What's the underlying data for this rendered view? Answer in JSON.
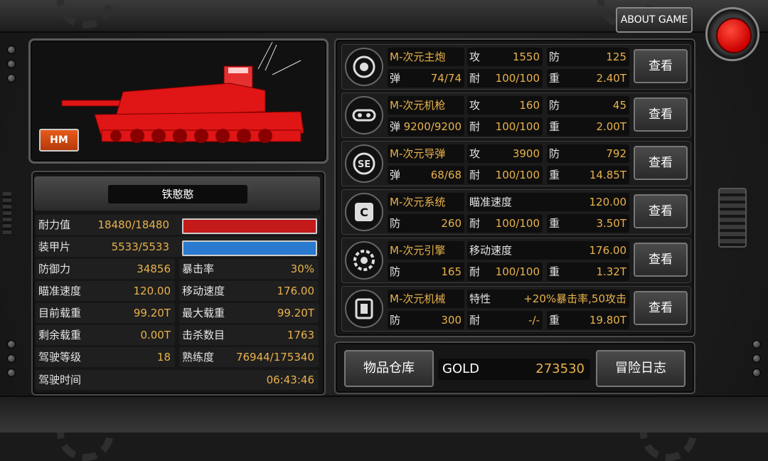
{
  "top": {
    "about_label": "ABOUT GAME"
  },
  "tank": {
    "tag": "HM",
    "name": "铁憨憨"
  },
  "stats": {
    "hp": {
      "label": "耐力值",
      "value": "18480/18480",
      "fill": 1.0
    },
    "armor": {
      "label": "装甲片",
      "value": "5533/5533",
      "fill": 1.0
    },
    "rows": [
      {
        "l1": "防御力",
        "v1": "34856",
        "l2": "暴击率",
        "v2": "30%"
      },
      {
        "l1": "瞄准速度",
        "v1": "120.00",
        "l2": "移动速度",
        "v2": "176.00"
      },
      {
        "l1": "目前载重",
        "v1": "99.20T",
        "l2": "最大载重",
        "v2": "99.20T"
      },
      {
        "l1": "剩余载重",
        "v1": "0.00T",
        "l2": "击杀数目",
        "v2": "1763"
      },
      {
        "l1": "驾驶等级",
        "v1": "18",
        "l2": "熟练度",
        "v2": "76944/175340"
      }
    ],
    "drive_time": {
      "label": "驾驶时间",
      "value": "06:43:46"
    }
  },
  "equipment": [
    {
      "name": "M-次元主炮",
      "k1": "攻",
      "v1": "1550",
      "k2": "防",
      "v2": "125",
      "k3": "弹",
      "v3": "74/74",
      "k4": "耐",
      "v4": "100/100",
      "k5": "重",
      "v5": "2.40T",
      "icon": "cannon-icon"
    },
    {
      "name": "M-次元机枪",
      "k1": "攻",
      "v1": "160",
      "k2": "防",
      "v2": "45",
      "k3": "弹",
      "v3": "9200/9200",
      "k4": "耐",
      "v4": "100/100",
      "k5": "重",
      "v5": "2.00T",
      "icon": "machinegun-icon"
    },
    {
      "name": "M-次元导弹",
      "k1": "攻",
      "v1": "3900",
      "k2": "防",
      "v2": "792",
      "k3": "弹",
      "v3": "68/68",
      "k4": "耐",
      "v4": "100/100",
      "k5": "重",
      "v5": "14.85T",
      "icon": "missile-se-icon"
    },
    {
      "name": "M-次元系统",
      "k1": "瞄准速度",
      "v1": "120.00",
      "k2": "",
      "v2": "",
      "k3": "防",
      "v3": "260",
      "k4": "耐",
      "v4": "100/100",
      "k5": "重",
      "v5": "3.50T",
      "icon": "system-c-icon"
    },
    {
      "name": "M-次元引擎",
      "k1": "移动速度",
      "v1": "176.00",
      "k2": "",
      "v2": "",
      "k3": "防",
      "v3": "165",
      "k4": "耐",
      "v4": "100/100",
      "k5": "重",
      "v5": "1.32T",
      "icon": "engine-icon"
    },
    {
      "name": "M-次元机械",
      "k1": "特性",
      "v1": "+20%暴击率,50攻击",
      "k2": "",
      "v2": "",
      "k3": "防",
      "v3": "300",
      "k4": "耐",
      "v4": "-/-",
      "k5": "重",
      "v5": "19.80T",
      "icon": "chassis-icon"
    }
  ],
  "view_label": "查看",
  "bottom": {
    "inventory_label": "物品仓库",
    "gold_label": "GOLD",
    "gold_value": "273530",
    "log_label": "冒险日志"
  },
  "colors": {
    "accent": "#e9b24b",
    "hp_bar": "#c41a1a",
    "armor_bar": "#2a7ad0",
    "tank": "#e01515"
  }
}
